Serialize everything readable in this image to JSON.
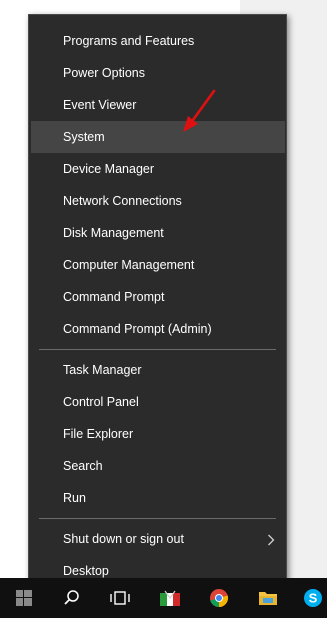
{
  "menu": {
    "items": [
      {
        "label": "Programs and Features"
      },
      {
        "label": "Power Options"
      },
      {
        "label": "Event Viewer"
      },
      {
        "label": "System"
      },
      {
        "label": "Device Manager"
      },
      {
        "label": "Network Connections"
      },
      {
        "label": "Disk Management"
      },
      {
        "label": "Computer Management"
      },
      {
        "label": "Command Prompt"
      },
      {
        "label": "Command Prompt (Admin)"
      },
      {
        "label": "Task Manager"
      },
      {
        "label": "Control Panel"
      },
      {
        "label": "File Explorer"
      },
      {
        "label": "Search"
      },
      {
        "label": "Run"
      },
      {
        "label": "Shut down or sign out"
      },
      {
        "label": "Desktop"
      }
    ],
    "hovered_item": "System",
    "annotation_arrow_color": "#e01010"
  },
  "taskbar": {
    "icons": [
      "windows-start-icon",
      "search-icon",
      "task-view-icon",
      "media-app-icon",
      "chrome-icon",
      "file-explorer-icon",
      "skype-icon"
    ]
  },
  "colors": {
    "menu_background": "#2b2b2b",
    "hover_background": "#454545",
    "taskbar": "#101010"
  }
}
